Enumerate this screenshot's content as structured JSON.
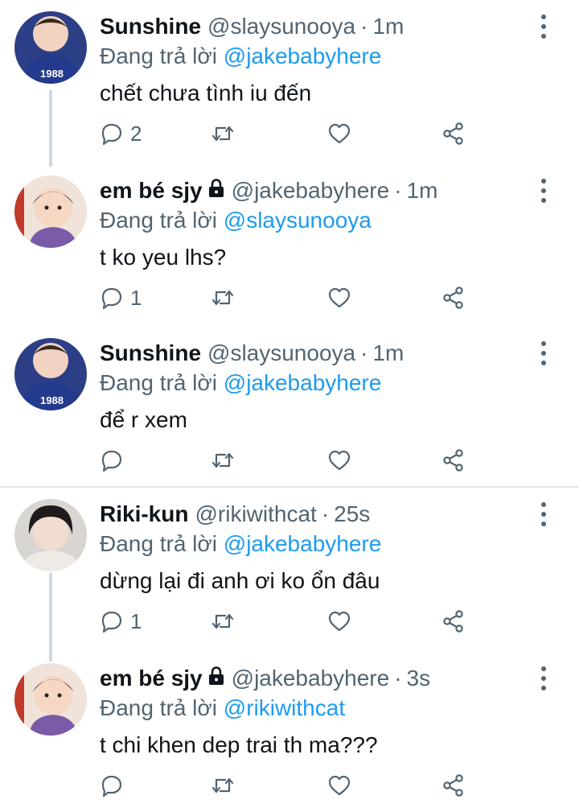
{
  "reply_prefix": "Đang trả lời",
  "tweets": [
    {
      "name": "Sunshine",
      "locked": false,
      "handle": "@slaysunooya",
      "time": "1m",
      "replying_to": "@jakebabyhere",
      "text": "chết chưa tình iu đến",
      "reply_count": "2",
      "retweet_count": "",
      "like_count": "",
      "avatar": "sunshine-avatar"
    },
    {
      "name": "em bé sjy",
      "locked": true,
      "handle": "@jakebabyhere",
      "time": "1m",
      "replying_to": "@slaysunooya",
      "text": "t ko yeu lhs?",
      "reply_count": "1",
      "retweet_count": "",
      "like_count": "",
      "avatar": "baby-avatar"
    },
    {
      "name": "Sunshine",
      "locked": false,
      "handle": "@slaysunooya",
      "time": "1m",
      "replying_to": "@jakebabyhere",
      "text": "để r xem",
      "reply_count": "",
      "retweet_count": "",
      "like_count": "",
      "avatar": "sunshine-avatar"
    },
    {
      "name": "Riki-kun",
      "locked": false,
      "handle": "@rikiwithcat",
      "time": "25s",
      "replying_to": "@jakebabyhere",
      "text": "dừng lại đi anh ơi ko ổn đâu",
      "reply_count": "1",
      "retweet_count": "",
      "like_count": "",
      "avatar": "riki-avatar"
    },
    {
      "name": "em bé sjy",
      "locked": true,
      "handle": "@jakebabyhere",
      "time": "3s",
      "replying_to": "@rikiwithcat",
      "text": "t chi khen dep trai th ma???",
      "reply_count": "",
      "retweet_count": "",
      "like_count": "",
      "avatar": "baby-avatar"
    }
  ],
  "avatar_badge_text": "1988",
  "colors": {
    "link": "#1d9bf0",
    "muted": "#536471",
    "text": "#0f1419",
    "thread_line": "#cfd9de",
    "divider": "#e1e8ed"
  },
  "icons": {
    "reply": "reply-icon",
    "retweet": "retweet-icon",
    "like": "heart-icon",
    "share": "share-icon",
    "more": "more-icon",
    "lock": "lock-icon"
  }
}
